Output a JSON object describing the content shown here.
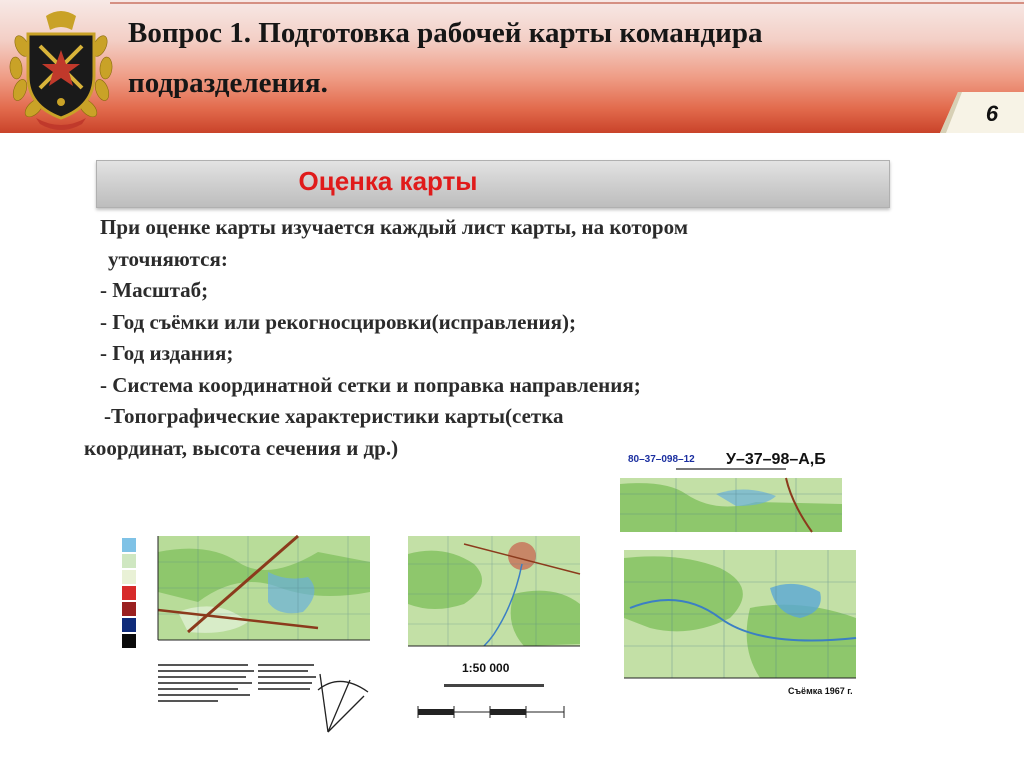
{
  "header": {
    "title_line1": "Вопрос 1. Подготовка рабочей карты командира",
    "title_line2": "подразделения.",
    "slide_number": "6"
  },
  "section": {
    "title": "Оценка карты"
  },
  "content": {
    "lines": [
      "При оценке карты изучается каждый лист карты, на котором",
      "уточняются:",
      "- Масштаб;",
      "- Год съёмки или рекогносцировки(исправления);",
      "- Год издания;",
      "- Система координатной сетки и поправка направления;",
      "-Топографические характеристики карты(сетка",
      "координат, высота сечения и др.)"
    ]
  },
  "maps": {
    "sheet_code_left": "80–37–098–12",
    "sheet_code_right": "У–37–98–А,Б",
    "scale_label": "1:50 000",
    "survey_label": "Съёмка 1967 г."
  },
  "colors": {
    "banner_red": "#c9432a",
    "section_title_red": "#e01b1b",
    "map_green": "#9bc97a",
    "map_blue": "#5aa7d6"
  }
}
